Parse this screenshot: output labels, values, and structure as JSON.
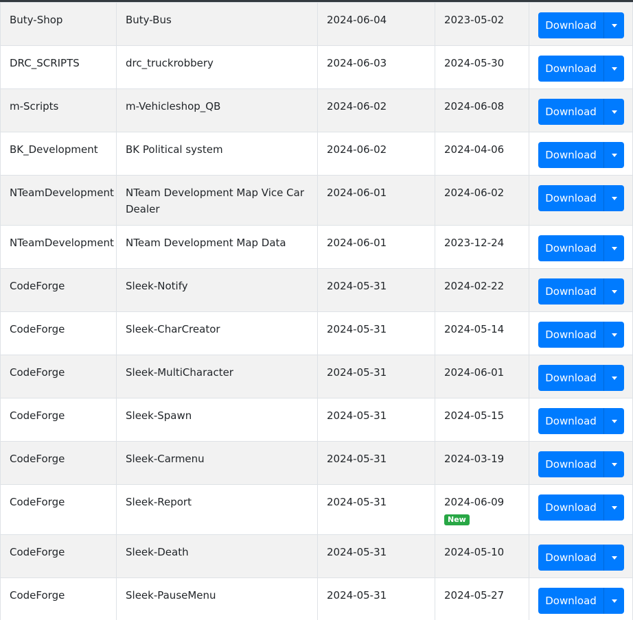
{
  "table": {
    "rows": [
      {
        "author": "Buty-Shop",
        "name": "Buty-Bus",
        "date_added": "2024-06-04",
        "date_updated": "2023-05-02",
        "badge": "",
        "button_label": "Download"
      },
      {
        "author": "DRC_SCRIPTS",
        "name": "drc_truckrobbery",
        "date_added": "2024-06-03",
        "date_updated": "2024-05-30",
        "badge": "",
        "button_label": "Download"
      },
      {
        "author": "m-Scripts",
        "name": "m-Vehicleshop_QB",
        "date_added": "2024-06-02",
        "date_updated": "2024-06-08",
        "badge": "",
        "button_label": "Download"
      },
      {
        "author": "BK_Development",
        "name": "BK Political system",
        "date_added": "2024-06-02",
        "date_updated": "2024-04-06",
        "badge": "",
        "button_label": "Download"
      },
      {
        "author": "NTeamDevelopment",
        "name": "NTeam Development Map Vice Car Dealer",
        "date_added": "2024-06-01",
        "date_updated": "2024-06-02",
        "badge": "",
        "button_label": "Download"
      },
      {
        "author": "NTeamDevelopment",
        "name": "NTeam Development Map Data",
        "date_added": "2024-06-01",
        "date_updated": "2023-12-24",
        "badge": "",
        "button_label": "Download"
      },
      {
        "author": "CodeForge",
        "name": "Sleek-Notify",
        "date_added": "2024-05-31",
        "date_updated": "2024-02-22",
        "badge": "",
        "button_label": "Download"
      },
      {
        "author": "CodeForge",
        "name": "Sleek-CharCreator",
        "date_added": "2024-05-31",
        "date_updated": "2024-05-14",
        "badge": "",
        "button_label": "Download"
      },
      {
        "author": "CodeForge",
        "name": "Sleek-MultiCharacter",
        "date_added": "2024-05-31",
        "date_updated": "2024-06-01",
        "badge": "",
        "button_label": "Download"
      },
      {
        "author": "CodeForge",
        "name": "Sleek-Spawn",
        "date_added": "2024-05-31",
        "date_updated": "2024-05-15",
        "badge": "",
        "button_label": "Download"
      },
      {
        "author": "CodeForge",
        "name": "Sleek-Carmenu",
        "date_added": "2024-05-31",
        "date_updated": "2024-03-19",
        "badge": "",
        "button_label": "Download"
      },
      {
        "author": "CodeForge",
        "name": "Sleek-Report",
        "date_added": "2024-05-31",
        "date_updated": "2024-06-09",
        "badge": "New",
        "button_label": "Download"
      },
      {
        "author": "CodeForge",
        "name": "Sleek-Death",
        "date_added": "2024-05-31",
        "date_updated": "2024-05-10",
        "badge": "",
        "button_label": "Download"
      },
      {
        "author": "CodeForge",
        "name": "Sleek-PauseMenu",
        "date_added": "2024-05-31",
        "date_updated": "2024-05-27",
        "badge": "",
        "button_label": "Download"
      }
    ]
  },
  "colors": {
    "header_bar": "#343a40",
    "button_primary": "#007bff",
    "badge_new": "#28a745",
    "row_stripe": "#f2f2f2"
  },
  "icons": {
    "dropdown_toggle": "caret-down-icon"
  }
}
